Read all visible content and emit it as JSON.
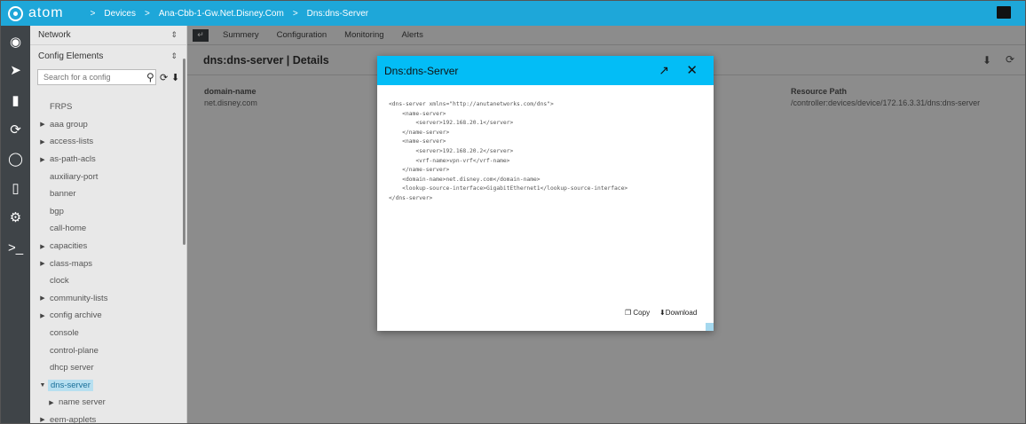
{
  "header": {
    "logo_text": "atom",
    "breadcrumbs": [
      "Devices",
      "Ana-Cbb-1-Gw.Net.Disney.Com",
      "Dns:dns-Server"
    ]
  },
  "sidebar": {
    "network_label": "Network",
    "config_label": "Config Elements",
    "search_placeholder": "Search for a config",
    "items": [
      {
        "label": "FRPS",
        "arrow": false
      },
      {
        "label": "aaa group",
        "arrow": true
      },
      {
        "label": "access-lists",
        "arrow": true
      },
      {
        "label": "as-path-acls",
        "arrow": true
      },
      {
        "label": "auxiliary-port",
        "arrow": false
      },
      {
        "label": "banner",
        "arrow": false
      },
      {
        "label": "bgp",
        "arrow": false
      },
      {
        "label": "call-home",
        "arrow": false
      },
      {
        "label": "capacities",
        "arrow": true
      },
      {
        "label": "class-maps",
        "arrow": true
      },
      {
        "label": "clock",
        "arrow": false
      },
      {
        "label": "community-lists",
        "arrow": true
      },
      {
        "label": "config archive",
        "arrow": true
      },
      {
        "label": "console",
        "arrow": false
      },
      {
        "label": "control-plane",
        "arrow": false
      },
      {
        "label": "dhcp server",
        "arrow": false
      },
      {
        "label": "dns-server",
        "arrow": true,
        "expanded": true,
        "selected": true
      },
      {
        "label": "name server",
        "arrow": true,
        "child": true
      },
      {
        "label": "eem-applets",
        "arrow": true
      }
    ]
  },
  "main": {
    "tabs": [
      "Summery",
      "Configuration",
      "Monitoring",
      "Alerts"
    ],
    "title": "dns:dns-server | Details",
    "fields": [
      {
        "label": "domain-name",
        "value": "net.disney.com"
      },
      {
        "label": "Resource Path",
        "value": "/controller:devices/device/172.16.3.31/dns:dns-server"
      }
    ]
  },
  "modal": {
    "title": "Dns:dns-Server",
    "code": "<dns-server xmlns=\"http://anutanetworks.com/dns\">\n    <name-server>\n        <server>192.168.20.1</server>\n    </name-server>\n    <name-server>\n        <server>192.168.20.2</server>\n        <vrf-name>vpn-vrf</vrf-name>\n    </name-server>\n    <domain-name>net.disney.com</domain-name>\n    <lookup-source-interface>GigabitEthernet1</lookup-source-interface>\n</dns-server>",
    "copy_label": "Copy",
    "download_label": "Download"
  },
  "colors": {
    "topbar": "#1ea7d9",
    "modal_header": "#03bdf6",
    "rail": "#3f4448"
  }
}
